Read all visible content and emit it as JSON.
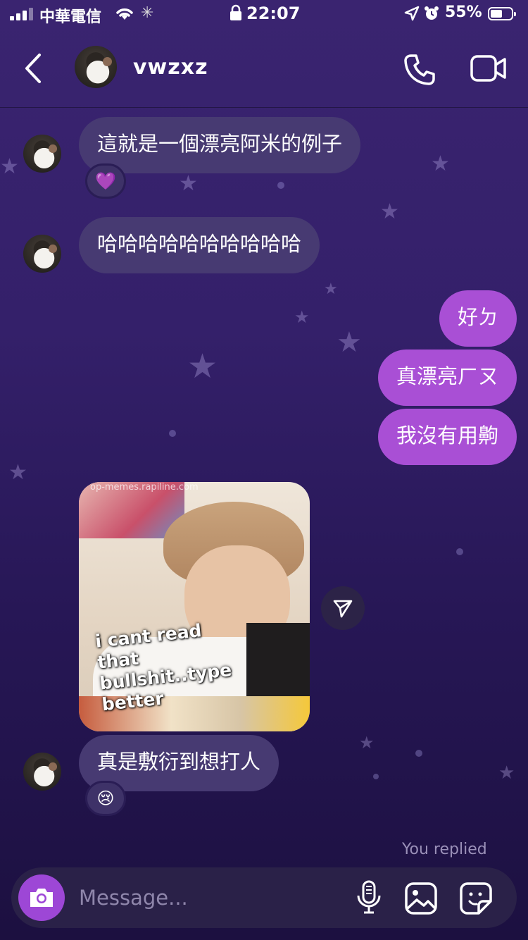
{
  "status_bar": {
    "carrier": "中華電信",
    "time": "22:07",
    "battery": "55%"
  },
  "header": {
    "name": "vwzxz",
    "icons": [
      "back-chevron-icon",
      "phone-icon",
      "video-camera-icon"
    ]
  },
  "messages": [
    {
      "from": "them",
      "text": "這就是一個漂亮阿米的例子",
      "reaction": "💜"
    },
    {
      "from": "them",
      "text": "哈哈哈哈哈哈哈哈哈哈"
    },
    {
      "from": "me",
      "text": "好ㄉ"
    },
    {
      "from": "me",
      "text": "真漂亮ㄏㄡ"
    },
    {
      "from": "me",
      "text": "我沒有用齁"
    },
    {
      "from": "them",
      "type": "image",
      "watermark": "op-memes.rapiline.com",
      "caption": "i cant read\nthat\nbullshit..type\nbetter"
    },
    {
      "from": "them",
      "text": "真是敷衍到想打人",
      "reaction": "😢"
    }
  ],
  "footer_note": "You replied",
  "composer": {
    "placeholder": "Message...",
    "icons": [
      "camera-icon",
      "microphone-icon",
      "image-gallery-icon",
      "sticker-icon"
    ]
  },
  "colors": {
    "background_top": "#3a2470",
    "background_bottom": "#1c1040",
    "incoming_bubble": "#473a72",
    "outgoing_bubble": "#a94fd5",
    "camera_button": "#9d47d6"
  }
}
